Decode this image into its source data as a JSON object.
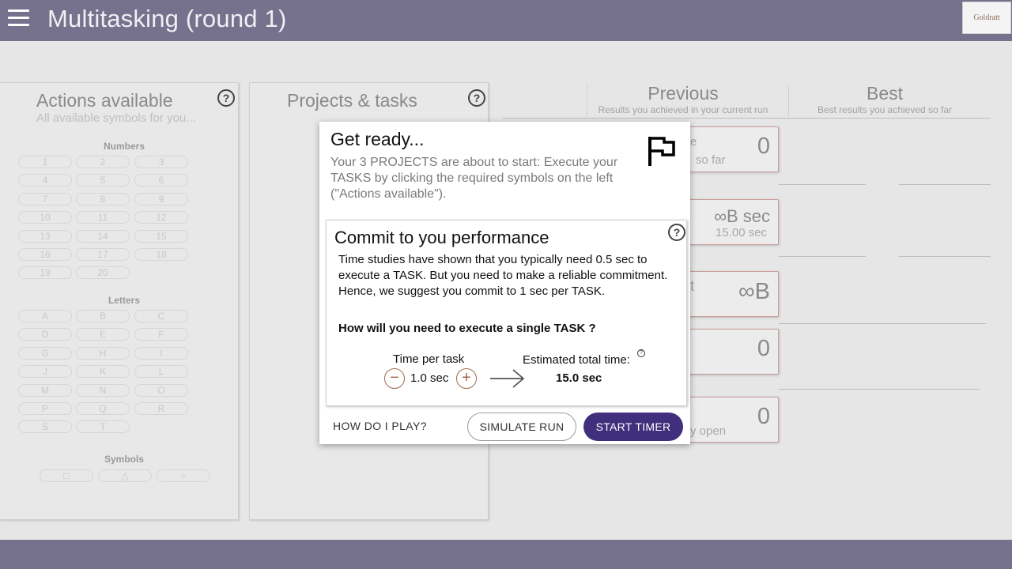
{
  "header": {
    "title": "Multitasking (round 1)",
    "logo_text": "Goldratt"
  },
  "actions_panel": {
    "title": "Actions available",
    "subtitle": "All available symbols for you...",
    "numbers_label": "Numbers",
    "numbers": [
      "1",
      "2",
      "3",
      "4",
      "5",
      "6",
      "7",
      "8",
      "9",
      "10",
      "11",
      "12",
      "13",
      "14",
      "15",
      "16",
      "17",
      "18",
      "19",
      "20"
    ],
    "letters_label": "Letters",
    "letters": [
      "A",
      "B",
      "C",
      "D",
      "E",
      "F",
      "G",
      "H",
      "I",
      "J",
      "K",
      "L",
      "M",
      "N",
      "O",
      "P",
      "Q",
      "R",
      "S",
      "T"
    ],
    "symbols_label": "Symbols",
    "symbols": [
      "□",
      "△",
      "○"
    ]
  },
  "projects_panel": {
    "title": "Projects & tasks"
  },
  "results": {
    "previous_title": "Previous",
    "previous_sub": "Results you achieved in your current run",
    "best_title": "Best",
    "best_sub": "Best results you achieved so far",
    "cards": [
      {
        "value": "0",
        "frag_top": "e",
        "frag_bottom": "so far"
      },
      {
        "value": "∞B sec",
        "frag_bottom": "15.00 sec"
      },
      {
        "value": "∞B",
        "frag_top": "t"
      },
      {
        "value": "0"
      },
      {
        "value": "0",
        "frag_bottom": "y open"
      }
    ]
  },
  "modal": {
    "title": "Get ready...",
    "description": "Your 3 PROJECTS are about to start: Execute your TASKS by clicking the required symbols on the left (\"Actions available\").",
    "commit_title": "Commit to you performance",
    "commit_text": "Time studies have shown that you typically need 0.5 sec to execute a TASK. But you need to make a reliable commitment. Hence, we suggest you commit to 1 sec per TASK.",
    "question": "How will you need to execute a single TASK ?",
    "time_per_task_label": "Time per task",
    "time_per_task_value": "1.0 sec",
    "decrease_symbol": "−",
    "increase_symbol": "+",
    "estimated_label": "Estimated total time:",
    "estimated_value": "15.0 sec",
    "how_to_play": "HOW DO I PLAY?",
    "simulate": "SIMULATE RUN",
    "start": "START TIMER"
  },
  "help_symbol": "?"
}
